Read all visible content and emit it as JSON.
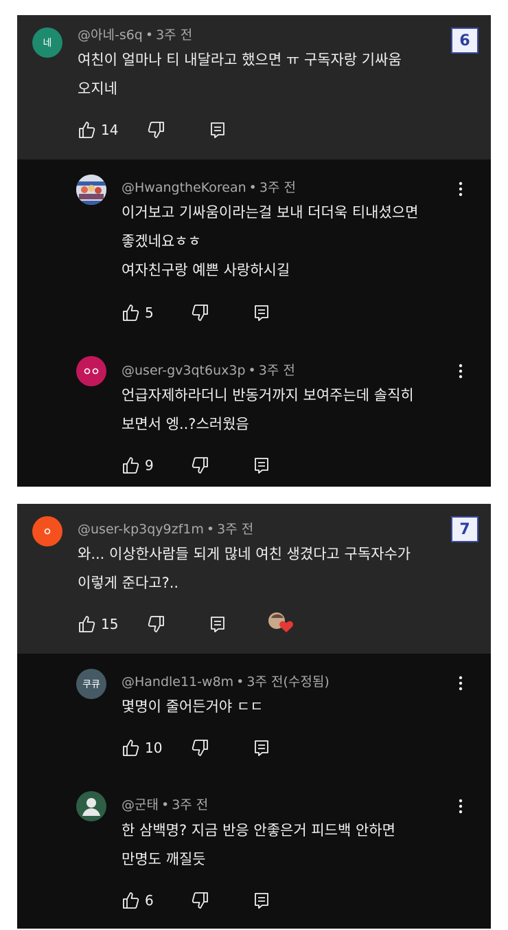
{
  "sections": [
    {
      "badge": "6",
      "comment": {
        "avatar_text": "네",
        "avatar_color": "#1e8a6e",
        "author": "@아네-s6q",
        "time": "3주 전",
        "lines": [
          "여친이 얼마나 티 내달라고 했으면 ㅠ 구독자랑 기싸움",
          "오지네"
        ],
        "likes": "14"
      },
      "replies": [
        {
          "author": "@HwangtheKorean",
          "time": "3주 전",
          "lines": [
            "이거보고 기싸움이라는걸 보내 더더욱 티내셨으면",
            "좋겠네요ㅎㅎ",
            "여자친구랑 예쁜 사랑하시길"
          ],
          "likes": "5"
        },
        {
          "avatar_text": "oo",
          "avatar_color": "#c2185b",
          "author": "@user-gv3qt6ux3p",
          "time": "3주 전",
          "lines": [
            "언급자제하라더니 반동거까지 보여주는데 솔직히",
            "보면서 엥..?스러웠음"
          ],
          "likes": "9"
        }
      ]
    },
    {
      "badge": "7",
      "comment": {
        "avatar_text": "o",
        "avatar_color": "#f4511e",
        "author": "@user-kp3qy9zf1m",
        "time": "3주 전",
        "lines": [
          "와... 이상한사람들 되게 많네 여친 생겼다고 구독자수가",
          "이렇게 준다고?.."
        ],
        "likes": "15"
      },
      "replies": [
        {
          "avatar_text": "쿠큐",
          "avatar_color": "#455a64",
          "author": "@Handle11-w8m",
          "time": "3주 전(수정됨)",
          "lines": [
            "몇명이 줄어든거야 ㄷㄷ"
          ],
          "likes": "10"
        },
        {
          "avatar_color": "#2e5e46",
          "author": "@군태",
          "time": "3주 전",
          "lines": [
            "한 삼백명? 지금 반응 안좋은거 피드백 안하면",
            "만명도 깨질듯"
          ],
          "likes": "6"
        }
      ]
    }
  ]
}
